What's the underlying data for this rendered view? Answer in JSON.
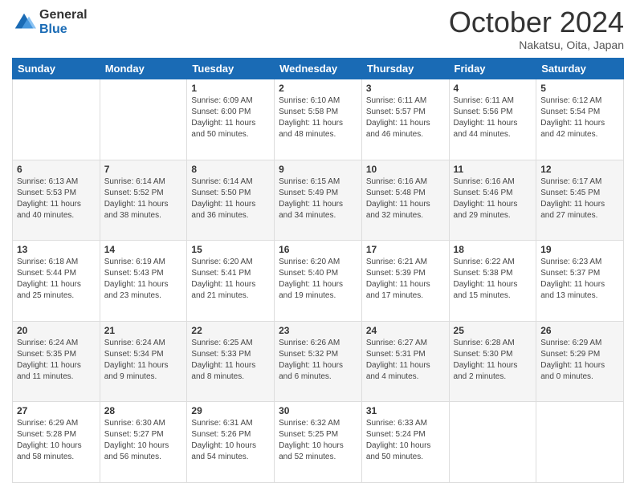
{
  "header": {
    "logo": {
      "general": "General",
      "blue": "Blue"
    },
    "title": "October 2024",
    "subtitle": "Nakatsu, Oita, Japan"
  },
  "calendar": {
    "days_of_week": [
      "Sunday",
      "Monday",
      "Tuesday",
      "Wednesday",
      "Thursday",
      "Friday",
      "Saturday"
    ],
    "weeks": [
      [
        {
          "day": "",
          "info": ""
        },
        {
          "day": "",
          "info": ""
        },
        {
          "day": "1",
          "info": "Sunrise: 6:09 AM\nSunset: 6:00 PM\nDaylight: 11 hours and 50 minutes."
        },
        {
          "day": "2",
          "info": "Sunrise: 6:10 AM\nSunset: 5:58 PM\nDaylight: 11 hours and 48 minutes."
        },
        {
          "day": "3",
          "info": "Sunrise: 6:11 AM\nSunset: 5:57 PM\nDaylight: 11 hours and 46 minutes."
        },
        {
          "day": "4",
          "info": "Sunrise: 6:11 AM\nSunset: 5:56 PM\nDaylight: 11 hours and 44 minutes."
        },
        {
          "day": "5",
          "info": "Sunrise: 6:12 AM\nSunset: 5:54 PM\nDaylight: 11 hours and 42 minutes."
        }
      ],
      [
        {
          "day": "6",
          "info": "Sunrise: 6:13 AM\nSunset: 5:53 PM\nDaylight: 11 hours and 40 minutes."
        },
        {
          "day": "7",
          "info": "Sunrise: 6:14 AM\nSunset: 5:52 PM\nDaylight: 11 hours and 38 minutes."
        },
        {
          "day": "8",
          "info": "Sunrise: 6:14 AM\nSunset: 5:50 PM\nDaylight: 11 hours and 36 minutes."
        },
        {
          "day": "9",
          "info": "Sunrise: 6:15 AM\nSunset: 5:49 PM\nDaylight: 11 hours and 34 minutes."
        },
        {
          "day": "10",
          "info": "Sunrise: 6:16 AM\nSunset: 5:48 PM\nDaylight: 11 hours and 32 minutes."
        },
        {
          "day": "11",
          "info": "Sunrise: 6:16 AM\nSunset: 5:46 PM\nDaylight: 11 hours and 29 minutes."
        },
        {
          "day": "12",
          "info": "Sunrise: 6:17 AM\nSunset: 5:45 PM\nDaylight: 11 hours and 27 minutes."
        }
      ],
      [
        {
          "day": "13",
          "info": "Sunrise: 6:18 AM\nSunset: 5:44 PM\nDaylight: 11 hours and 25 minutes."
        },
        {
          "day": "14",
          "info": "Sunrise: 6:19 AM\nSunset: 5:43 PM\nDaylight: 11 hours and 23 minutes."
        },
        {
          "day": "15",
          "info": "Sunrise: 6:20 AM\nSunset: 5:41 PM\nDaylight: 11 hours and 21 minutes."
        },
        {
          "day": "16",
          "info": "Sunrise: 6:20 AM\nSunset: 5:40 PM\nDaylight: 11 hours and 19 minutes."
        },
        {
          "day": "17",
          "info": "Sunrise: 6:21 AM\nSunset: 5:39 PM\nDaylight: 11 hours and 17 minutes."
        },
        {
          "day": "18",
          "info": "Sunrise: 6:22 AM\nSunset: 5:38 PM\nDaylight: 11 hours and 15 minutes."
        },
        {
          "day": "19",
          "info": "Sunrise: 6:23 AM\nSunset: 5:37 PM\nDaylight: 11 hours and 13 minutes."
        }
      ],
      [
        {
          "day": "20",
          "info": "Sunrise: 6:24 AM\nSunset: 5:35 PM\nDaylight: 11 hours and 11 minutes."
        },
        {
          "day": "21",
          "info": "Sunrise: 6:24 AM\nSunset: 5:34 PM\nDaylight: 11 hours and 9 minutes."
        },
        {
          "day": "22",
          "info": "Sunrise: 6:25 AM\nSunset: 5:33 PM\nDaylight: 11 hours and 8 minutes."
        },
        {
          "day": "23",
          "info": "Sunrise: 6:26 AM\nSunset: 5:32 PM\nDaylight: 11 hours and 6 minutes."
        },
        {
          "day": "24",
          "info": "Sunrise: 6:27 AM\nSunset: 5:31 PM\nDaylight: 11 hours and 4 minutes."
        },
        {
          "day": "25",
          "info": "Sunrise: 6:28 AM\nSunset: 5:30 PM\nDaylight: 11 hours and 2 minutes."
        },
        {
          "day": "26",
          "info": "Sunrise: 6:29 AM\nSunset: 5:29 PM\nDaylight: 11 hours and 0 minutes."
        }
      ],
      [
        {
          "day": "27",
          "info": "Sunrise: 6:29 AM\nSunset: 5:28 PM\nDaylight: 10 hours and 58 minutes."
        },
        {
          "day": "28",
          "info": "Sunrise: 6:30 AM\nSunset: 5:27 PM\nDaylight: 10 hours and 56 minutes."
        },
        {
          "day": "29",
          "info": "Sunrise: 6:31 AM\nSunset: 5:26 PM\nDaylight: 10 hours and 54 minutes."
        },
        {
          "day": "30",
          "info": "Sunrise: 6:32 AM\nSunset: 5:25 PM\nDaylight: 10 hours and 52 minutes."
        },
        {
          "day": "31",
          "info": "Sunrise: 6:33 AM\nSunset: 5:24 PM\nDaylight: 10 hours and 50 minutes."
        },
        {
          "day": "",
          "info": ""
        },
        {
          "day": "",
          "info": ""
        }
      ]
    ]
  }
}
